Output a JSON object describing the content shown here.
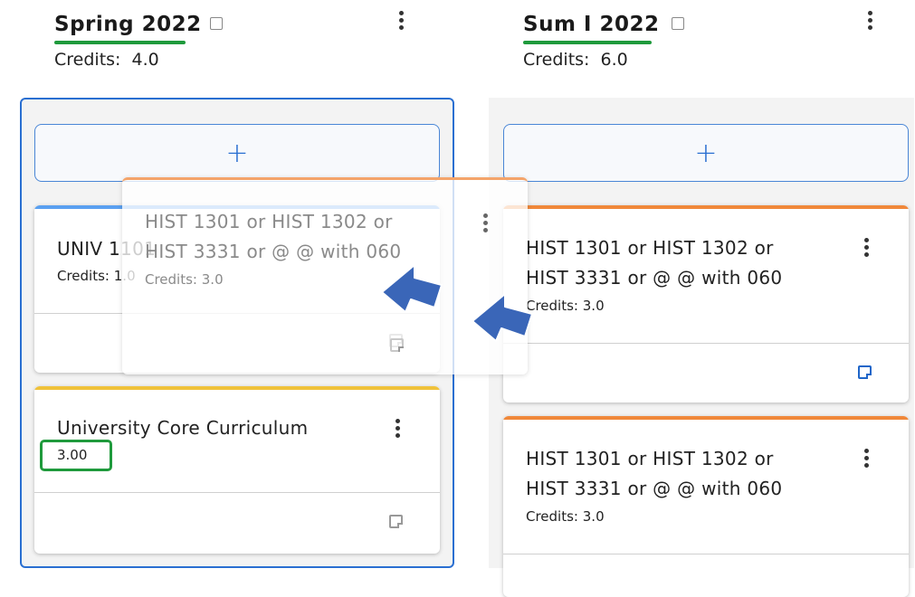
{
  "terms": [
    {
      "title": "Spring 2022",
      "credits_label": "Credits:",
      "credits_value": "4.0",
      "add_label": "+",
      "cards": [
        {
          "title": "UNIV 1101",
          "credits_label": "Credits:",
          "credits_value": "1.0",
          "accent": "#5aa0f0"
        },
        {
          "title": "University Core Curriculum",
          "credits_display": "3.00",
          "accent": "#f0c23a"
        }
      ]
    },
    {
      "title": "Sum I 2022",
      "credits_label": "Credits:",
      "credits_value": "6.0",
      "add_label": "+",
      "cards": [
        {
          "line1": "HIST 1301 or HIST 1302 or",
          "line2": "HIST 3331 or @ @ with 060",
          "credits_label": "Credits:",
          "credits_value": "3.0",
          "accent": "#f0883a"
        },
        {
          "line1": "HIST 1301 or HIST 1302 or",
          "line2": "HIST 3331 or @ @ with 060",
          "credits_label": "Credits:",
          "credits_value": "3.0",
          "accent": "#f0883a"
        }
      ]
    }
  ],
  "dragging_card": {
    "line1": "HIST 1301 or HIST 1302 or",
    "line2": "HIST 3331 or @ @ with 060",
    "credits_label": "Credits:",
    "credits_value": "3.0"
  },
  "colors": {
    "highlight": "#1f9a3c",
    "arrow": "#3a66b8",
    "selected_column_border": "#2a6fd1"
  }
}
